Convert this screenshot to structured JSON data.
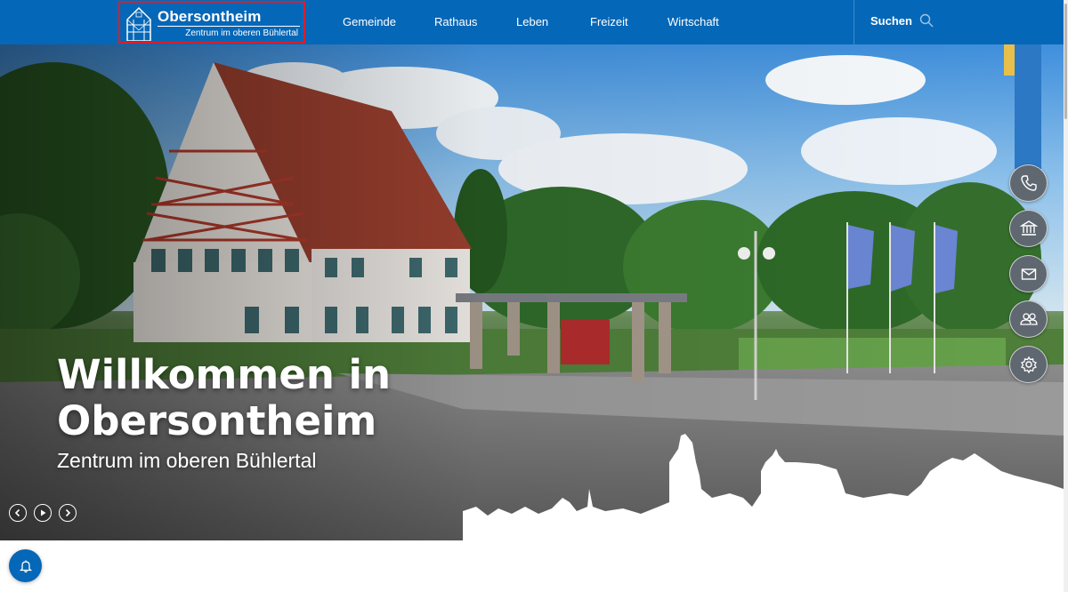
{
  "logo": {
    "name": "Obersontheim",
    "tagline": "Zentrum im oberen Bühlertal"
  },
  "nav": {
    "items": [
      {
        "label": "Gemeinde"
      },
      {
        "label": "Rathaus"
      },
      {
        "label": "Leben"
      },
      {
        "label": "Freizeit"
      },
      {
        "label": "Wirtschaft"
      }
    ]
  },
  "search": {
    "label": "Suchen",
    "icon": "search-icon"
  },
  "hero": {
    "title": "Willkommen in Obersontheim",
    "subtitle": "Zentrum im oberen Bühlertal",
    "controls": [
      "prev-icon",
      "play-icon",
      "next-icon"
    ]
  },
  "quick_links": [
    "phone-icon",
    "town-hall-icon",
    "mail-icon",
    "people-icon",
    "gear-icon"
  ],
  "notification": {
    "icon": "bell-icon"
  },
  "colors": {
    "brand": "#0567b7",
    "accent_outline": "#d6202f",
    "quick_button": "#5f6770",
    "text_light": "#ffffff"
  }
}
